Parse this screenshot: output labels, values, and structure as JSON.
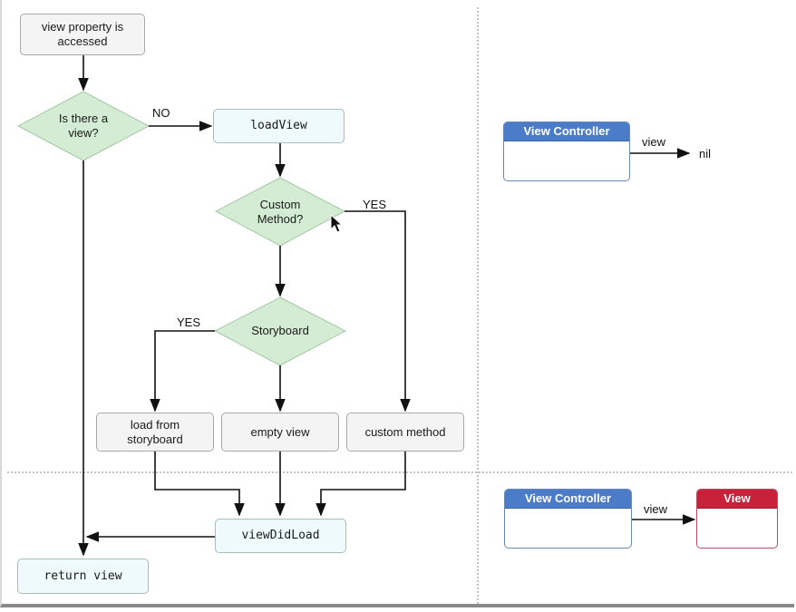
{
  "flowchart": {
    "start": "view property is accessed",
    "decision_view": "Is there a view?",
    "edge_no": "NO",
    "load_view": "loadView",
    "decision_custom": "Custom Method?",
    "edge_yes_custom": "YES",
    "decision_storyboard": "Storyboard",
    "edge_yes_storyboard": "YES",
    "load_storyboard": "load from storyboard",
    "empty_view": "empty view",
    "custom_method": "custom method",
    "view_did_load": "viewDidLoad",
    "return_view": "return view"
  },
  "state_before": {
    "object_title": "View Controller",
    "property_label": "view",
    "target": "nil"
  },
  "state_after": {
    "object_title": "View Controller",
    "property_label": "view",
    "target_title": "View"
  },
  "colors": {
    "decision_fill": "#d4ecd4",
    "view_controller_header": "#4a7cc9",
    "view_header": "#c8213a",
    "code_box_fill": "#eefafb"
  }
}
